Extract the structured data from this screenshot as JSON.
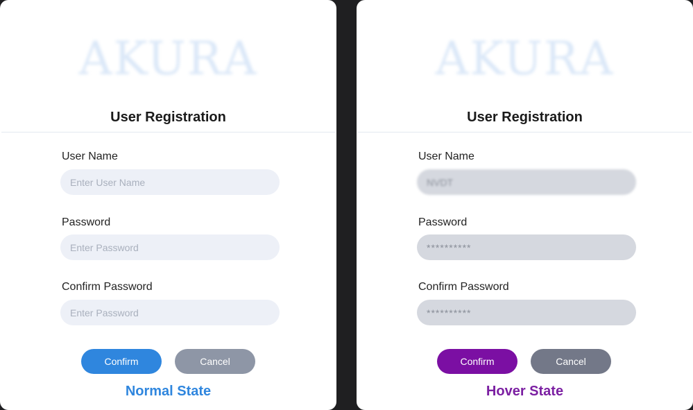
{
  "panels": [
    {
      "logo": "AKURA",
      "title": "User Registration",
      "fields": [
        {
          "label": "User Name",
          "placeholder": "Enter User Name",
          "value": ""
        },
        {
          "label": "Password",
          "placeholder": "Enter Password",
          "value": ""
        },
        {
          "label": "Confirm Password",
          "placeholder": "Enter Password",
          "value": ""
        }
      ],
      "confirm_label": "Confirm",
      "cancel_label": "Cancel",
      "state_label": "Normal State"
    },
    {
      "logo": "AKURA",
      "title": "User Registration",
      "fields": [
        {
          "label": "User Name",
          "placeholder": "",
          "value": "NVDT"
        },
        {
          "label": "Password",
          "placeholder": "",
          "value": "**********"
        },
        {
          "label": "Confirm Password",
          "placeholder": "",
          "value": "**********"
        }
      ],
      "confirm_label": "Confirm",
      "cancel_label": "Cancel",
      "state_label": "Hover State"
    }
  ],
  "colors": {
    "normal_confirm": "#2f86de",
    "normal_cancel": "#8e96a6",
    "hover_confirm": "#7b0fa3",
    "hover_cancel": "#737888",
    "normal_state_text": "#2f86de",
    "hover_state_text": "#7b1fa2"
  }
}
